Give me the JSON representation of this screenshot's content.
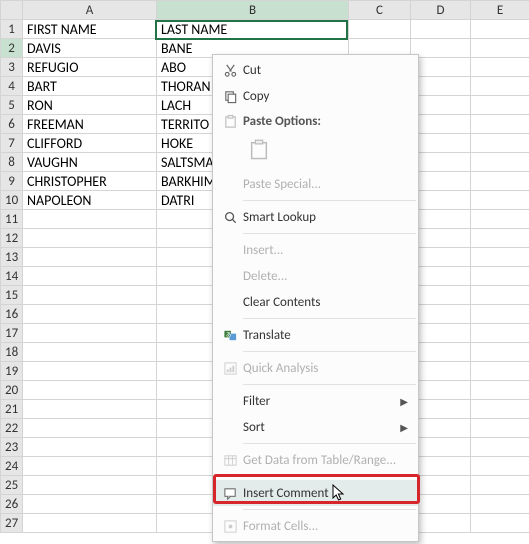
{
  "columns": [
    "A",
    "B",
    "C",
    "D",
    "E"
  ],
  "headers": {
    "A": "FIRST NAME",
    "B": "LAST NAME"
  },
  "rows": [
    {
      "n": 1,
      "A": "FIRST NAME",
      "B": "LAST NAME"
    },
    {
      "n": 2,
      "A": "DAVIS",
      "B": "BANE"
    },
    {
      "n": 3,
      "A": "REFUGIO",
      "B": "ABO"
    },
    {
      "n": 4,
      "A": "BART",
      "B": "THORAN"
    },
    {
      "n": 5,
      "A": "RON",
      "B": "LACH"
    },
    {
      "n": 6,
      "A": "FREEMAN",
      "B": "TERRITO"
    },
    {
      "n": 7,
      "A": "CLIFFORD",
      "B": "HOKE"
    },
    {
      "n": 8,
      "A": "VAUGHN",
      "B": "SALTSMA"
    },
    {
      "n": 9,
      "A": "CHRISTOPHER",
      "B": "BARKHIM"
    },
    {
      "n": 10,
      "A": "NAPOLEON",
      "B": "DATRI"
    }
  ],
  "total_rows": 27,
  "selected": {
    "row": 2,
    "col": "B"
  },
  "context_menu": {
    "cut": "Cut",
    "copy": "Copy",
    "paste_options": "Paste Options:",
    "paste_special": "Paste Special...",
    "smart_lookup": "Smart Lookup",
    "insert": "Insert...",
    "delete": "Delete...",
    "clear_contents": "Clear Contents",
    "translate": "Translate",
    "quick_analysis": "Quick Analysis",
    "filter": "Filter",
    "sort": "Sort",
    "get_data": "Get Data from Table/Range...",
    "insert_comment": "Insert Comment",
    "format_cells": "Format Cells..."
  }
}
